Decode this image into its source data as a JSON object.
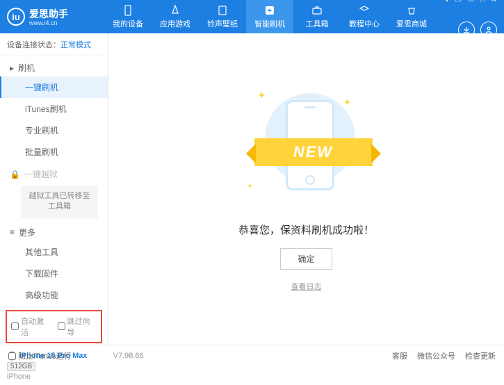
{
  "header": {
    "logo_letter": "iu",
    "app_name": "爱思助手",
    "url": "www.i4.cn",
    "nav": [
      {
        "label": "我的设备"
      },
      {
        "label": "应用游戏"
      },
      {
        "label": "铃声壁纸"
      },
      {
        "label": "智能刷机"
      },
      {
        "label": "工具箱"
      },
      {
        "label": "教程中心"
      },
      {
        "label": "爱思商城"
      }
    ]
  },
  "sidebar": {
    "status_label": "设备连接状态：",
    "status_value": "正常模式",
    "section_flash": "刷机",
    "items_flash": [
      "一键刷机",
      "iTunes刷机",
      "专业刷机",
      "批量刷机"
    ],
    "section_jailbreak": "一键越狱",
    "jailbreak_box": "越狱工具已转移至工具箱",
    "section_more": "更多",
    "items_more": [
      "其他工具",
      "下载固件",
      "高级功能"
    ],
    "checkbox_auto": "自动激活",
    "checkbox_skip": "跳过向导",
    "device_name": "iPhone 15 Pro Max",
    "storage": "512GB",
    "model": "iPhone"
  },
  "main": {
    "ribbon": "NEW",
    "message": "恭喜您，保资料刷机成功啦！",
    "confirm": "确定",
    "log_link": "查看日志"
  },
  "footer": {
    "block_itunes": "阻止iTunes运行",
    "version": "V7.98.66",
    "links": [
      "客服",
      "微信公众号",
      "检查更新"
    ]
  }
}
